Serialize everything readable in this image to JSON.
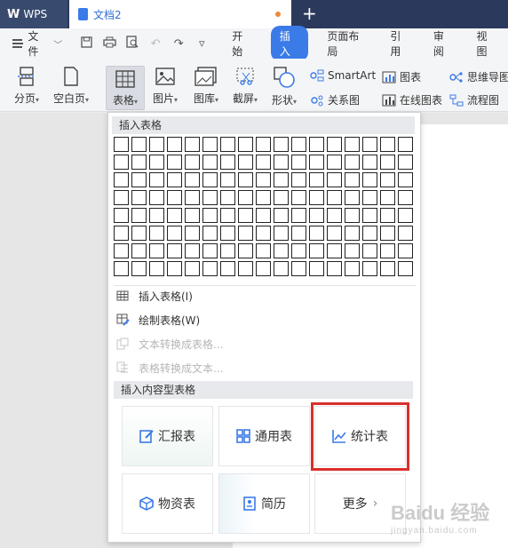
{
  "titlebar": {
    "app_tab": "WPS",
    "doc_tab": "文档2",
    "new_tab": "+"
  },
  "menu": {
    "file": "文件",
    "tabs": [
      "开始",
      "插入",
      "页面布局",
      "引用",
      "审阅",
      "视图"
    ],
    "active_tab": "插入"
  },
  "ribbon": {
    "page_break": "分页",
    "blank_page": "空白页",
    "table": "表格",
    "picture": "图片",
    "gallery": "图库",
    "screenshot": "截屏",
    "shape": "形状",
    "smartart": "SmartArt",
    "chart": "图表",
    "mindmap": "思维导图",
    "relation_chart": "关系图",
    "online_chart": "在线图表",
    "flowchart": "流程图"
  },
  "dropdown": {
    "insert_table_header": "插入表格",
    "grid_cols": 17,
    "grid_rows": 8,
    "items": [
      {
        "label": "插入表格(I)",
        "enabled": true
      },
      {
        "label": "绘制表格(W)",
        "enabled": true
      },
      {
        "label": "文本转换成表格...",
        "enabled": false
      },
      {
        "label": "表格转换成文本...",
        "enabled": false
      }
    ],
    "content_header": "插入内容型表格",
    "cards": [
      {
        "label": "汇报表"
      },
      {
        "label": "通用表"
      },
      {
        "label": "统计表",
        "highlighted": true
      },
      {
        "label": "物资表"
      },
      {
        "label": "简历"
      },
      {
        "label": "更多",
        "suffix": "›"
      }
    ]
  },
  "watermark": {
    "main": "Baidu 经验",
    "sub": "jingyan.baidu.com"
  },
  "colors": {
    "accent": "#3b7be8",
    "titlebar": "#2b3a5c",
    "highlight": "#d9302c"
  }
}
